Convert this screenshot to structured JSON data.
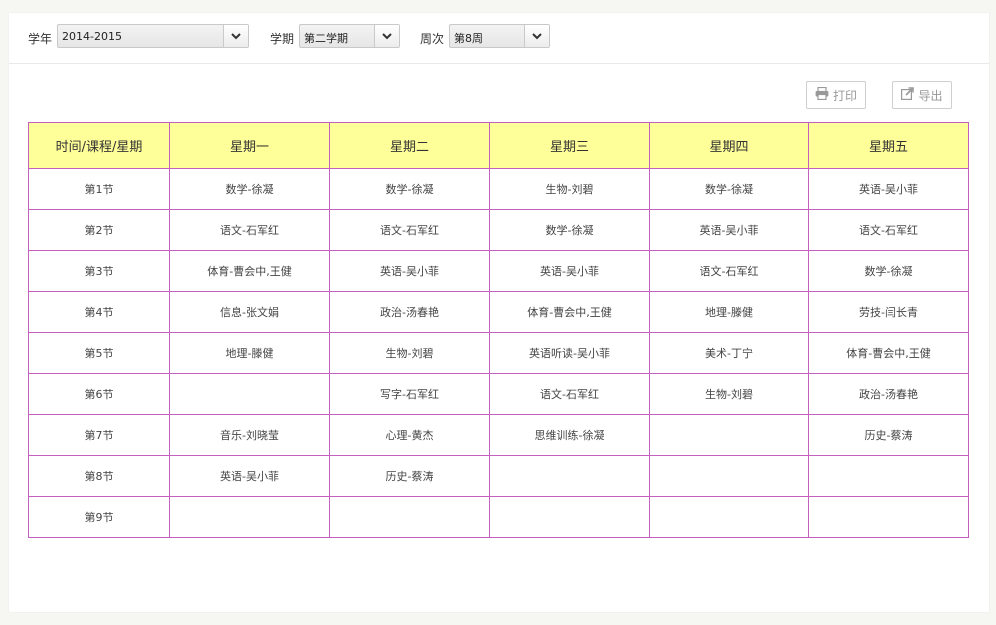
{
  "filters": {
    "year_label": "学年",
    "year_value": "2014-2015",
    "term_label": "学期",
    "term_value": "第二学期",
    "week_label": "周次",
    "week_value": "第8周"
  },
  "toolbar": {
    "print_label": "打印",
    "export_label": "导出"
  },
  "timetable": {
    "headers": [
      "时间/课程/星期",
      "星期一",
      "星期二",
      "星期三",
      "星期四",
      "星期五"
    ],
    "rows": [
      {
        "period": "第1节",
        "cells": [
          "数学-徐凝",
          "数学-徐凝",
          "生物-刘碧",
          "数学-徐凝",
          "英语-吴小菲"
        ]
      },
      {
        "period": "第2节",
        "cells": [
          "语文-石军红",
          "语文-石军红",
          "数学-徐凝",
          "英语-吴小菲",
          "语文-石军红"
        ]
      },
      {
        "period": "第3节",
        "cells": [
          "体育-曹会中,王健",
          "英语-吴小菲",
          "英语-吴小菲",
          "语文-石军红",
          "数学-徐凝"
        ]
      },
      {
        "period": "第4节",
        "cells": [
          "信息-张文娟",
          "政治-汤春艳",
          "体育-曹会中,王健",
          "地理-滕健",
          "劳技-闫长青"
        ]
      },
      {
        "period": "第5节",
        "cells": [
          "地理-滕健",
          "生物-刘碧",
          "英语听读-吴小菲",
          "美术-丁宁",
          "体育-曹会中,王健"
        ]
      },
      {
        "period": "第6节",
        "cells": [
          "",
          "写字-石军红",
          "语文-石军红",
          "生物-刘碧",
          "政治-汤春艳"
        ]
      },
      {
        "period": "第7节",
        "cells": [
          "音乐-刘晓莹",
          "心理-黄杰",
          "思维训练-徐凝",
          "",
          "历史-蔡涛"
        ]
      },
      {
        "period": "第8节",
        "cells": [
          "英语-吴小菲",
          "历史-蔡涛",
          "",
          "",
          ""
        ]
      },
      {
        "period": "第9节",
        "cells": [
          "",
          "",
          "",
          "",
          ""
        ]
      }
    ]
  },
  "icons": {
    "dropdown": "chevron-down-icon",
    "print": "printer-icon",
    "export": "export-icon"
  },
  "colors": {
    "header_bg": "#ffff99",
    "table_border": "#c45fbf"
  }
}
